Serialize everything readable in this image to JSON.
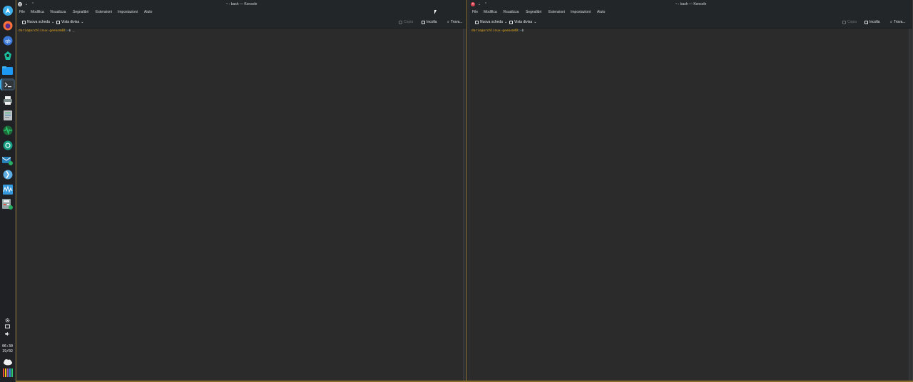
{
  "panel": {
    "launchers": [
      {
        "name": "application-launcher-icon",
        "color": "#3daee9"
      },
      {
        "name": "firefox-icon",
        "color": "#ff7139"
      },
      {
        "name": "qbittorrent-icon",
        "color": "#3c78d8"
      },
      {
        "name": "kde-connect-icon",
        "color": "#1abc9c"
      },
      {
        "name": "file-manager-icon",
        "color": "#3daee9"
      },
      {
        "name": "konsole-icon",
        "color": "#eff0f1"
      },
      {
        "name": "printer-icon",
        "color": "#bdc3c7"
      },
      {
        "name": "text-editor-icon",
        "color": "#8fbc8f"
      },
      {
        "name": "system-monitor-icon",
        "color": "#2ecc71"
      },
      {
        "name": "network-icon",
        "color": "#16a085"
      },
      {
        "name": "email-client-icon",
        "color": "#2980b9"
      },
      {
        "name": "browser-globe-icon",
        "color": "#5dade2"
      },
      {
        "name": "spectrum-app-icon",
        "color": "#3498db"
      },
      {
        "name": "calculator-icon",
        "color": "#95a5a6"
      }
    ],
    "tray": [
      {
        "name": "settings-tray-icon",
        "glyph": "⚙"
      },
      {
        "name": "display-tray-icon",
        "glyph": "▭"
      },
      {
        "name": "volume-tray-icon",
        "glyph": "🔊"
      }
    ],
    "clock_time": "06:30",
    "clock_date": "19/02"
  },
  "windows": [
    {
      "id": "left",
      "title": "~ : bash — Konsole",
      "menu": [
        "File",
        "Modifica",
        "Visualizza",
        "Segnalibri",
        "Estensioni",
        "Impostazioni",
        "Aiuto"
      ],
      "toolbar": {
        "new_tab": "Nuova scheda",
        "split_view": "Vista divisa",
        "copy": "Copia",
        "paste": "Incolla",
        "find": "Trova..."
      },
      "prompt": {
        "user": "dario",
        "host": "archlinux-geekom48",
        "path": "~",
        "symbol": "$",
        "cursor": "_"
      },
      "active": true
    },
    {
      "id": "right",
      "title": "~ : bash — Konsole",
      "menu": [
        "File",
        "Modifica",
        "Visualizza",
        "Segnalibri",
        "Estensioni",
        "Impostazioni",
        "Aiuto"
      ],
      "toolbar": {
        "new_tab": "Nuova scheda",
        "split_view": "Vista divisa",
        "copy": "Copia",
        "paste": "Incolla",
        "find": "Trova..."
      },
      "prompt": {
        "user": "dario",
        "host": "archlinux-geekom48",
        "path": "~",
        "symbol": "$",
        "cursor": ""
      },
      "active": false
    }
  ],
  "colors": {
    "accent": "#3daee9",
    "prompt_user": "#e0a81f",
    "active_border": "#8a6d2a",
    "close_button": "#da4453"
  }
}
